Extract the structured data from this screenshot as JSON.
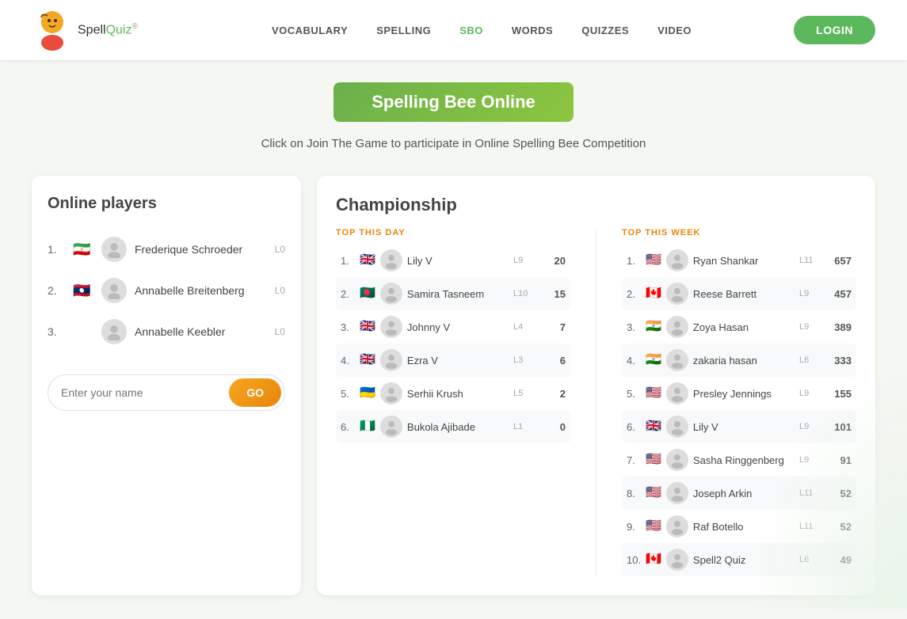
{
  "header": {
    "logo_spell": "Spell",
    "logo_quiz": "Quiz",
    "logo_reg": "®",
    "nav_items": [
      {
        "label": "VOCABULARY",
        "active": false
      },
      {
        "label": "SPELLING",
        "active": false
      },
      {
        "label": "SBO",
        "active": true
      },
      {
        "label": "WORDS",
        "active": false
      },
      {
        "label": "QUIZZES",
        "active": false
      },
      {
        "label": "VIDEO",
        "active": false
      }
    ],
    "login_label": "LOGIN"
  },
  "hero": {
    "badge_text": "Spelling Bee Online",
    "subtitle": "Click on Join The Game to participate in Online Spelling Bee Competition"
  },
  "online_players": {
    "title": "Online players",
    "players": [
      {
        "rank": "1.",
        "flag": "ir",
        "name": "Frederique Schroeder",
        "level": "L0"
      },
      {
        "rank": "2.",
        "flag": "la",
        "name": "Annabelle Breitenberg",
        "level": "L0"
      },
      {
        "rank": "3.",
        "flag": "none",
        "name": "Annabelle Keebler",
        "level": "L0"
      }
    ],
    "input_placeholder": "Enter your name",
    "go_label": "GO"
  },
  "championship": {
    "title": "Championship",
    "top_this_day": {
      "header": "TOP THIS DAY",
      "players": [
        {
          "rank": "1.",
          "flag": "gb",
          "avatar_emoji": "🧒",
          "name": "Lily V",
          "level": "L9",
          "score": "20"
        },
        {
          "rank": "2.",
          "flag": "bd",
          "avatar_emoji": "👤",
          "name": "Samira Tasneem",
          "level": "L10",
          "score": "15"
        },
        {
          "rank": "3.",
          "flag": "gb",
          "avatar_emoji": "🧒",
          "name": "Johnny V",
          "level": "L4",
          "score": "7"
        },
        {
          "rank": "4.",
          "flag": "gb",
          "avatar_emoji": "🧒",
          "name": "Ezra V",
          "level": "L3",
          "score": "6"
        },
        {
          "rank": "5.",
          "flag": "ua",
          "avatar_emoji": "👤",
          "name": "Serhii Krush",
          "level": "L5",
          "score": "2"
        },
        {
          "rank": "6.",
          "flag": "ng",
          "avatar_emoji": "👤",
          "name": "Bukola Ajibade",
          "level": "L1",
          "score": "0"
        }
      ]
    },
    "top_this_week": {
      "header": "TOP THIS WEEK",
      "players": [
        {
          "rank": "1.",
          "flag": "us",
          "avatar_emoji": "👤",
          "name": "Ryan Shankar",
          "level": "L11",
          "score": "657"
        },
        {
          "rank": "2.",
          "flag": "ca",
          "avatar_emoji": "👤",
          "name": "Reese Barrett",
          "level": "L9",
          "score": "457"
        },
        {
          "rank": "3.",
          "flag": "in",
          "avatar_emoji": "🧒",
          "name": "Zoya Hasan",
          "level": "L9",
          "score": "389"
        },
        {
          "rank": "4.",
          "flag": "in",
          "avatar_emoji": "🧒",
          "name": "zakaria hasan",
          "level": "L6",
          "score": "333"
        },
        {
          "rank": "5.",
          "flag": "us",
          "avatar_emoji": "👤",
          "name": "Presley Jennings",
          "level": "L9",
          "score": "155"
        },
        {
          "rank": "6.",
          "flag": "gb",
          "avatar_emoji": "🧒",
          "name": "Lily V",
          "level": "L9",
          "score": "101"
        },
        {
          "rank": "7.",
          "flag": "us",
          "avatar_emoji": "👤",
          "name": "Sasha Ringgenberg",
          "level": "L9",
          "score": "91"
        },
        {
          "rank": "8.",
          "flag": "us",
          "avatar_emoji": "👤",
          "name": "Joseph Arkin",
          "level": "L11",
          "score": "52"
        },
        {
          "rank": "9.",
          "flag": "us",
          "avatar_emoji": "👤",
          "name": "Raf Botello",
          "level": "L11",
          "score": "52"
        },
        {
          "rank": "10.",
          "flag": "ca",
          "avatar_emoji": "👤",
          "name": "Spell2 Quiz",
          "level": "L6",
          "score": "49"
        }
      ]
    }
  },
  "flags": {
    "gb": "🇬🇧",
    "us": "🇺🇸",
    "ca": "🇨🇦",
    "in": "🇮🇳",
    "ir": "🇮🇷",
    "la": "🇱🇦",
    "bd": "🇧🇩",
    "ua": "🇺🇦",
    "ng": "🇳🇬",
    "none": ""
  }
}
